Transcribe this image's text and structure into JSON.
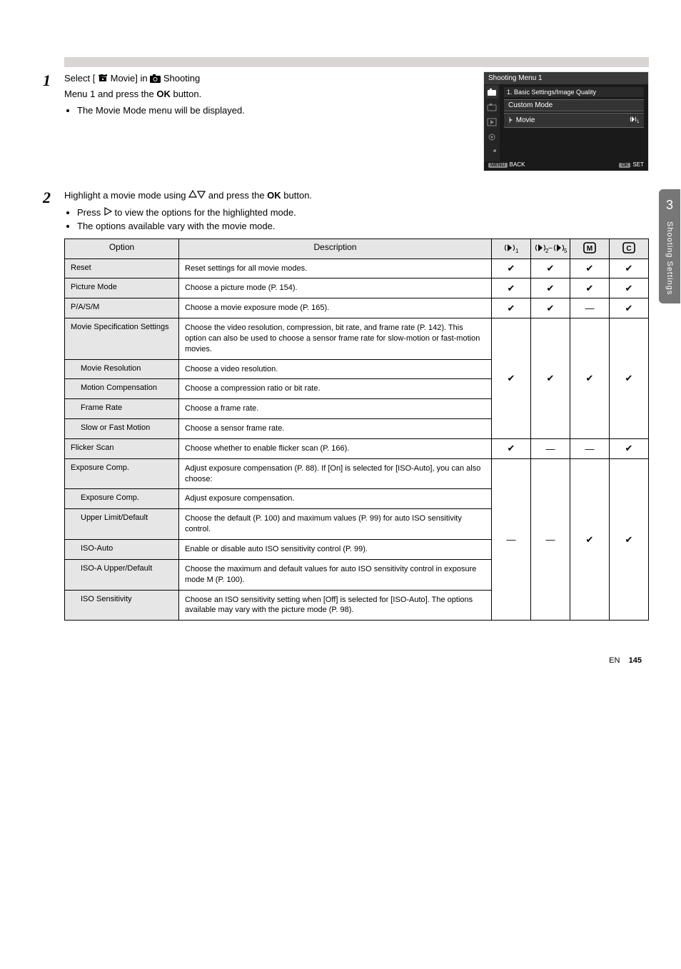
{
  "bar_text": " ",
  "steps": {
    "one_num": "1",
    "one_line1_a": "Select [",
    "one_mid1": " Movie] in ",
    "one_mid2": " Shooting",
    "one_line2": "Menu 1 and press the ",
    "one_line3_b": " button.",
    "bullet": "The Movie Mode menu will be displayed.",
    "two_num": "2",
    "two_line1": "Highlight a movie mode using ",
    "two_after_arrows": " and press the ",
    "two_bold_OK": "OK",
    "two_end": " button.",
    "two_bullets": [
      "Press ",
      " to view the options for the highlighted mode.",
      "The options available vary with the movie mode."
    ]
  },
  "screenshot": {
    "title": "Shooting Menu 1",
    "heading": "1. Basic Settings/Image Quality",
    "menus": [
      "Custom Mode",
      "Movie",
      "",
      "",
      "",
      ""
    ],
    "movie_value_icon": "movie-mode-icon",
    "back": "BACK",
    "set": "SET",
    "nav_labels": {
      "menu": "MENU",
      "ok": "OK"
    }
  },
  "tableHeaders": {
    "option": "Option",
    "description": "Description",
    "h1": "movie-mode-1-icon",
    "h2": "movie-mode-2-5-icon",
    "h3": "movie-M-icon",
    "h4": "movie-C-icon"
  },
  "rows": [
    {
      "opt": "Reset",
      "desc": "Reset settings for all movie modes.",
      "m": [
        "✔",
        "✔",
        "✔",
        "✔"
      ]
    },
    {
      "opt": "Picture Mode",
      "desc": "Choose a picture mode (P. 154).",
      "m": [
        "✔",
        "✔",
        "✔",
        "✔"
      ]
    },
    {
      "opt": "P/A/S/M",
      "desc": "Choose a movie exposure mode (P. 165).",
      "m": [
        "✔",
        "✔",
        "—",
        "✔"
      ]
    },
    {
      "opt": "Movie Specification Settings",
      "desc": "Choose the video resolution, compression, bit rate, and frame rate (P. 142). This option can also be used to choose a sensor frame rate for slow-motion or fast-motion movies.",
      "subrows": [
        {
          "opt": "Movie Resolution",
          "desc": "Choose a video resolution."
        },
        {
          "opt": "Motion Compensation",
          "desc": "Choose a compression ratio or bit rate."
        },
        {
          "opt": "Frame Rate",
          "desc": "Choose a frame rate."
        },
        {
          "opt": "Slow or Fast Motion",
          "desc": "Choose a sensor frame rate."
        }
      ],
      "m": [
        "✔",
        "✔",
        "✔",
        "✔"
      ]
    },
    {
      "opt": "Flicker Scan",
      "desc": "Choose whether to enable flicker scan (P. 166).",
      "m": [
        "✔",
        "—",
        "—",
        "✔"
      ]
    },
    {
      "opt": "Exposure Comp.",
      "desc": "Adjust exposure compensation (P. 88). If [On] is selected for [ISO-Auto], you can also choose:",
      "subrows": [
        {
          "opt": "Exposure Comp.",
          "desc": "Adjust exposure compensation."
        },
        {
          "opt": "Upper Limit/Default",
          "desc": "Choose the default (P. 100) and maximum values (P. 99) for auto ISO sensitivity control."
        },
        {
          "opt": "ISO-Auto",
          "desc": "Enable or disable auto ISO sensitivity control (P. 99)."
        },
        {
          "opt": "ISO-A Upper/Default",
          "desc": "Choose the maximum and default values for auto ISO sensitivity control in exposure mode M (P. 100)."
        },
        {
          "opt": "ISO Sensitivity",
          "desc": "Choose an ISO sensitivity setting when [Off] is selected for [ISO-Auto]. The options available may vary with the picture mode (P. 98)."
        }
      ],
      "m": [
        "—",
        "—",
        "✔",
        "✔"
      ]
    }
  ],
  "sideTab": {
    "num": "3",
    "label": "Shooting\nSettings"
  },
  "footer": {
    "left": "EN",
    "right": "145"
  }
}
